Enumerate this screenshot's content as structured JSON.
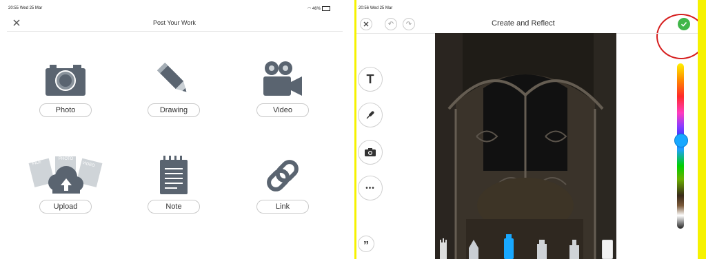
{
  "left_panel": {
    "status": {
      "time": "20:55",
      "date": "Wed 25 Mar",
      "battery": "46%"
    },
    "header": {
      "title": "Post Your Work"
    },
    "options": [
      {
        "label": "Photo",
        "icon": "camera-icon"
      },
      {
        "label": "Drawing",
        "icon": "pencil-icon"
      },
      {
        "label": "Video",
        "icon": "video-camera-icon"
      },
      {
        "label": "Upload",
        "icon": "cloud-upload-icon",
        "badges": [
          "FILE",
          "PHOTO",
          "VIDEO"
        ]
      },
      {
        "label": "Note",
        "icon": "notepad-icon"
      },
      {
        "label": "Link",
        "icon": "chain-link-icon"
      }
    ]
  },
  "right_panel": {
    "status": {
      "time": "20:56",
      "date": "Wed 25 Mar"
    },
    "header": {
      "title": "Create and Reflect"
    },
    "side_tools": [
      {
        "label": "T",
        "icon": "text-icon"
      },
      {
        "label": "",
        "icon": "microphone-icon"
      },
      {
        "label": "",
        "icon": "camera-icon"
      },
      {
        "label": "•••",
        "icon": "more-icon"
      }
    ],
    "quote_label": "”",
    "colors": {
      "accent": "#41b649",
      "annotation": "#d61f1f",
      "highlight": "#f6f200",
      "knob": "#18a8ff"
    }
  }
}
